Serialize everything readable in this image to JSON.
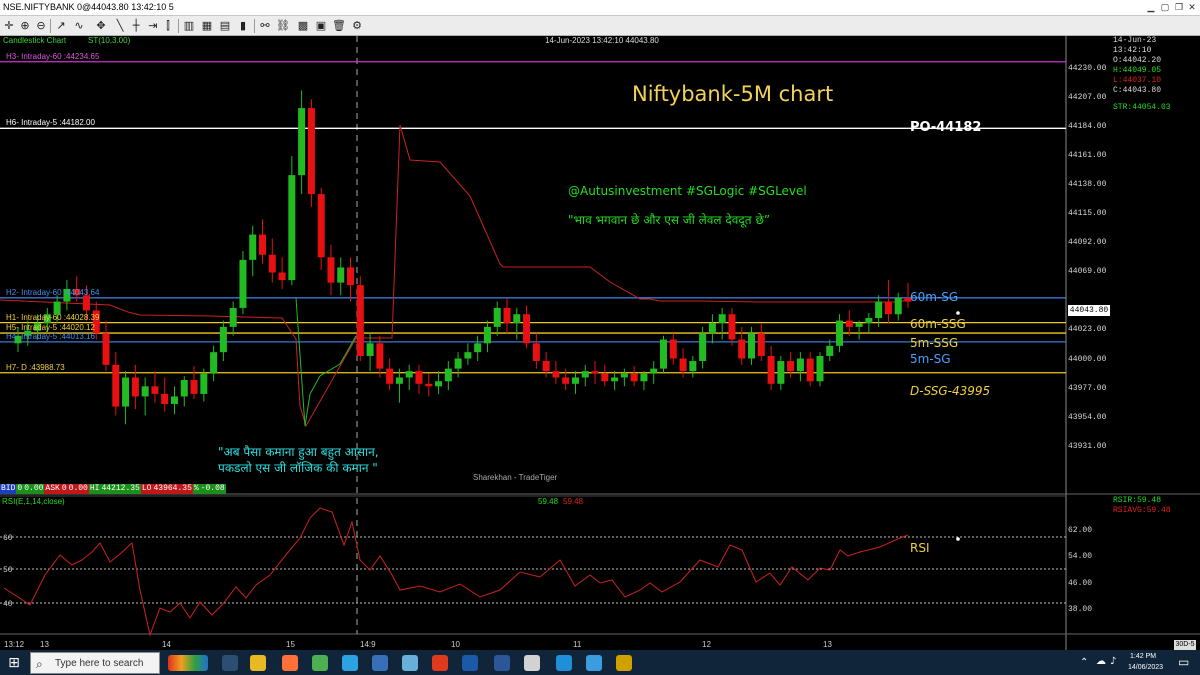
{
  "window": {
    "title": "NSE.NIFTYBANK 0@44043.80 13:42:10 5"
  },
  "chart_header": {
    "type_label": "Candlestick Chart",
    "indicator_label": "ST(10,3.00)",
    "cursor_info": "14-Jun-2023 13:42:10 44043.80"
  },
  "overlay_texts": {
    "title": "Niftybank-5M chart",
    "po": "PO-44182",
    "tags": "@Autusinvestment  #SGLogic  #SGLevel",
    "quote1": "\"भाव भगवान छे और एस जी लेवल देवदूत छे”",
    "quote2_line1": "\"अब पैसा कमाना हुआ बहुत आसान,",
    "quote2_line2": "पकडलो एस जी लॉजिक की कमान \"",
    "watermark": "Sharekhan - TradeTiger",
    "rsi_label": "RSI"
  },
  "level_lines": [
    {
      "label": "H3- Intraday-60 :44234.65",
      "price": 44234.65,
      "color": "#cc33cc"
    },
    {
      "label": "H6- Intraday-5 :44182.00",
      "price": 44182.0,
      "color": "#ffffff"
    },
    {
      "label": "H2- Intraday-60 :44043.64",
      "price": 44048.0,
      "color": "#3a78d8",
      "tag": "60m-SG",
      "tag_color": "#4aa0ff"
    },
    {
      "label": "H1- Intraday-60 :44028.39",
      "price": 44028.39,
      "color": "#f0c820",
      "tag": "60m-SSG",
      "tag_color": "#f0d040"
    },
    {
      "label": "H5- Intraday-5 :44020.12",
      "price": 44020.12,
      "color": "#f0c820",
      "tag": "5m-SSG",
      "tag_color": "#f0d040"
    },
    {
      "label": "H4- Intraday-5 :44013.16",
      "price": 44013.16,
      "color": "#3a78d8",
      "tag": "5m-SG",
      "tag_color": "#4aa0ff"
    },
    {
      "label": "H7- D :43988.73",
      "price": 43988.73,
      "color": "#f0c820",
      "tag": "D-SSG-43995",
      "tag_color": "#f0d040"
    }
  ],
  "price_axis": {
    "ticks": [
      "44230.00",
      "44207.00",
      "44184.00",
      "44161.00",
      "44138.00",
      "44115.00",
      "44092.00",
      "44069.00",
      "44023.00",
      "44000.00",
      "43977.00",
      "43954.00",
      "43931.00"
    ],
    "current_price": "44043.80"
  },
  "info_panel": {
    "date": "14-Jun-23",
    "time": "13:42:10",
    "open": "O:44042.20",
    "high": "H:44049.05",
    "low": "L:44037.10",
    "close": "C:44043.80",
    "str": "STR:44054.03"
  },
  "bid_bar": {
    "bid_label": "BID",
    "bid_val": "0",
    "bid_amt": "0.00",
    "ask_label": "ASK",
    "ask_val": "0",
    "ask_amt": "0.00",
    "hi_label": "HI",
    "hi_val": "44212.35",
    "lo_label": "LO",
    "lo_val": "43964.35",
    "pct_label": "%",
    "pct_val": "-0.08"
  },
  "rsi_panel": {
    "label": "RSI(E,1,14,close)",
    "values_green": "59.48",
    "values_red": "59.48",
    "rsir": "RSIR:59.48",
    "rsiavg": "RSIAVG:59.48",
    "left_ticks": [
      "60",
      "50",
      "40"
    ],
    "right_ticks": [
      "62.00",
      "54.00",
      "46.00",
      "38.00"
    ]
  },
  "time_axis": {
    "labels": [
      "13:12",
      "13",
      "14",
      "15",
      "14:9",
      "10",
      "11",
      "12",
      "13"
    ],
    "right_box": "30D-5"
  },
  "taskbar": {
    "search_placeholder": "Type here to search",
    "time": "1:42 PM",
    "date": "14/06/2023"
  },
  "colors": {
    "up": "#22bb22",
    "down": "#e81010",
    "supertrend": "#cc2222",
    "rsi_line": "#cc2222"
  },
  "chart_data": {
    "type": "candlestick",
    "title": "Niftybank-5M chart",
    "ylim": [
      43915,
      44255
    ],
    "ohlc": [
      [
        44012,
        44025,
        44005,
        44018
      ],
      [
        44018,
        44030,
        44010,
        44022
      ],
      [
        44022,
        44035,
        44015,
        44028
      ],
      [
        44028,
        44040,
        44020,
        44035
      ],
      [
        44035,
        44050,
        44028,
        44045
      ],
      [
        44045,
        44062,
        44038,
        44055
      ],
      [
        44055,
        44065,
        44045,
        44050
      ],
      [
        44050,
        44058,
        44030,
        44038
      ],
      [
        44038,
        44045,
        44015,
        44020
      ],
      [
        44020,
        44030,
        43990,
        43995
      ],
      [
        43995,
        44005,
        43955,
        43962
      ],
      [
        43962,
        43990,
        43948,
        43985
      ],
      [
        43985,
        43995,
        43960,
        43970
      ],
      [
        43970,
        43985,
        43955,
        43978
      ],
      [
        43978,
        43990,
        43965,
        43972
      ],
      [
        43972,
        43985,
        43958,
        43964
      ],
      [
        43964,
        43978,
        43956,
        43970
      ],
      [
        43970,
        43986,
        43962,
        43983
      ],
      [
        43983,
        43994,
        43968,
        43972
      ],
      [
        43972,
        43992,
        43966,
        43988
      ],
      [
        43988,
        44010,
        43982,
        44005
      ],
      [
        44005,
        44030,
        43998,
        44025
      ],
      [
        44025,
        44045,
        44018,
        44040
      ],
      [
        44040,
        44085,
        44035,
        44078
      ],
      [
        44078,
        44105,
        44065,
        44098
      ],
      [
        44098,
        44110,
        44075,
        44082
      ],
      [
        44082,
        44095,
        44060,
        44068
      ],
      [
        44068,
        44080,
        44055,
        44062
      ],
      [
        44062,
        44160,
        44058,
        44145
      ],
      [
        44145,
        44212,
        44130,
        44198
      ],
      [
        44198,
        44205,
        44120,
        44130
      ],
      [
        44130,
        44135,
        44070,
        44080
      ],
      [
        44080,
        44090,
        44050,
        44060
      ],
      [
        44060,
        44080,
        44050,
        44072
      ],
      [
        44072,
        44080,
        44045,
        44058
      ],
      [
        44058,
        44065,
        43998,
        44002
      ],
      [
        44002,
        44020,
        43990,
        44012
      ],
      [
        44012,
        44018,
        43985,
        43992
      ],
      [
        43992,
        44000,
        43975,
        43980
      ],
      [
        43980,
        43992,
        43965,
        43985
      ],
      [
        43985,
        43995,
        43975,
        43990
      ],
      [
        43990,
        43995,
        43972,
        43980
      ],
      [
        43980,
        43988,
        43970,
        43978
      ],
      [
        43978,
        43990,
        43972,
        43982
      ],
      [
        43982,
        43998,
        43975,
        43992
      ],
      [
        43992,
        44005,
        43985,
        44000
      ],
      [
        44000,
        44012,
        43995,
        44005
      ],
      [
        44005,
        44018,
        43998,
        44012
      ],
      [
        44012,
        44030,
        44005,
        44025
      ],
      [
        44025,
        44045,
        44018,
        44040
      ],
      [
        44040,
        44048,
        44020,
        44028
      ],
      [
        44028,
        44040,
        44015,
        44035
      ],
      [
        44035,
        44042,
        44008,
        44012
      ],
      [
        44012,
        44020,
        43992,
        43998
      ],
      [
        43998,
        44005,
        43985,
        43990
      ],
      [
        43990,
        43998,
        43980,
        43985
      ],
      [
        43985,
        43992,
        43975,
        43980
      ],
      [
        43980,
        43990,
        43972,
        43985
      ],
      [
        43985,
        43995,
        43978,
        43990
      ],
      [
        43990,
        43998,
        43980,
        43988
      ],
      [
        43988,
        43995,
        43978,
        43982
      ],
      [
        43982,
        43990,
        43975,
        43985
      ],
      [
        43985,
        43992,
        43978,
        43988
      ],
      [
        43988,
        43994,
        43978,
        43982
      ],
      [
        43982,
        43990,
        43975,
        43988
      ],
      [
        43988,
        43998,
        43980,
        43992
      ],
      [
        43992,
        44018,
        43988,
        44015
      ],
      [
        44015,
        44020,
        43995,
        44000
      ],
      [
        44000,
        44008,
        43985,
        43990
      ],
      [
        43990,
        44002,
        43985,
        43998
      ],
      [
        43998,
        44025,
        43992,
        44020
      ],
      [
        44020,
        44035,
        44012,
        44028
      ],
      [
        44028,
        44040,
        44015,
        44035
      ],
      [
        44035,
        44040,
        44010,
        44015
      ],
      [
        44015,
        44025,
        43995,
        44000
      ],
      [
        44000,
        44025,
        43995,
        44020
      ],
      [
        44020,
        44028,
        43998,
        44002
      ],
      [
        44002,
        44010,
        43975,
        43980
      ],
      [
        43980,
        44002,
        43975,
        43998
      ],
      [
        43998,
        44005,
        43985,
        43990
      ],
      [
        43990,
        44005,
        43982,
        44000
      ],
      [
        44000,
        44005,
        43978,
        43982
      ],
      [
        43982,
        44005,
        43978,
        44002
      ],
      [
        44002,
        44015,
        43998,
        44010
      ],
      [
        44010,
        44035,
        44005,
        44030
      ],
      [
        44030,
        44038,
        44018,
        44025
      ],
      [
        44025,
        44030,
        44015,
        44028
      ],
      [
        44028,
        44036,
        44020,
        44032
      ],
      [
        44032,
        44050,
        44025,
        44045
      ],
      [
        44045,
        44062,
        44028,
        44035
      ],
      [
        44035,
        44052,
        44030,
        44048
      ],
      [
        44048,
        44060,
        44040,
        44045
      ]
    ]
  }
}
